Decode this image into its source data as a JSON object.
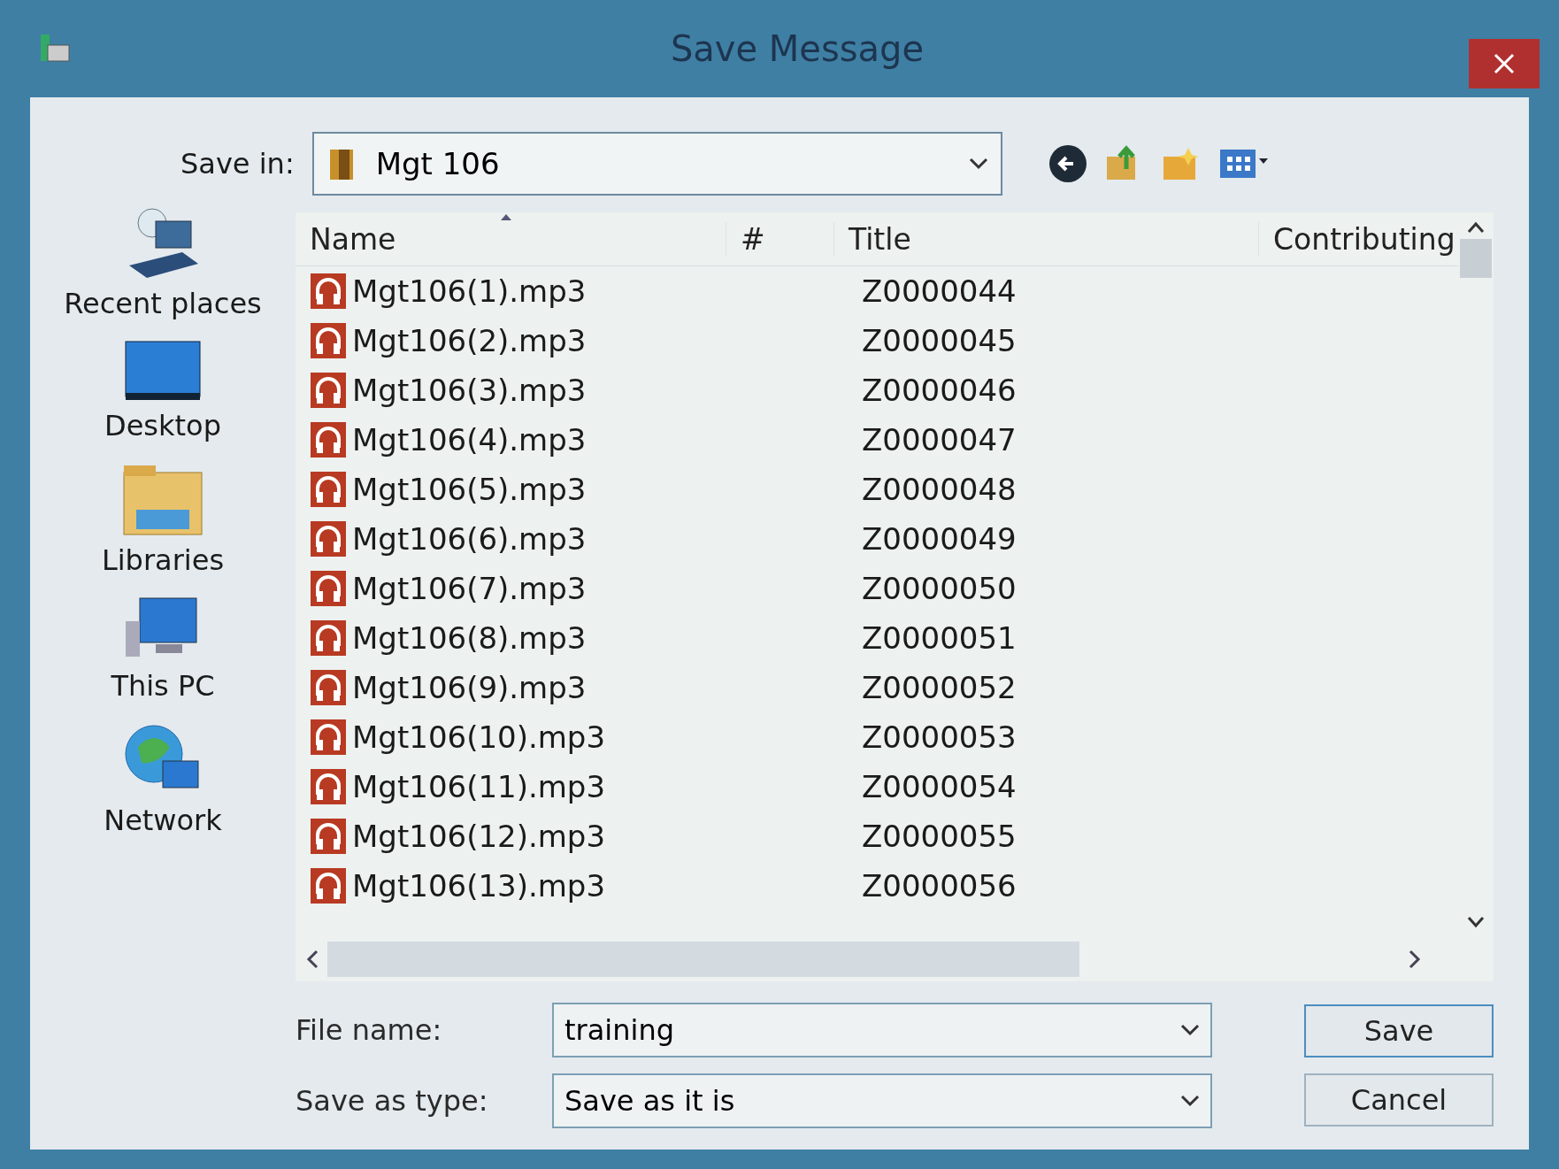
{
  "window": {
    "title": "Save Message"
  },
  "places": [
    {
      "kind": "recent",
      "label": "Recent places"
    },
    {
      "kind": "desktop",
      "label": "Desktop"
    },
    {
      "kind": "libraries",
      "label": "Libraries"
    },
    {
      "kind": "pc",
      "label": "This PC"
    },
    {
      "kind": "network",
      "label": "Network"
    }
  ],
  "save_in": {
    "label": "Save in:",
    "value": "Mgt 106"
  },
  "table": {
    "columns": [
      "Name",
      "#",
      "Title",
      "Contributing"
    ],
    "rows": [
      {
        "name": "Mgt106(1).mp3",
        "title": "Z0000044"
      },
      {
        "name": "Mgt106(2).mp3",
        "title": "Z0000045"
      },
      {
        "name": "Mgt106(3).mp3",
        "title": "Z0000046"
      },
      {
        "name": "Mgt106(4).mp3",
        "title": "Z0000047"
      },
      {
        "name": "Mgt106(5).mp3",
        "title": "Z0000048"
      },
      {
        "name": "Mgt106(6).mp3",
        "title": "Z0000049"
      },
      {
        "name": "Mgt106(7).mp3",
        "title": "Z0000050"
      },
      {
        "name": "Mgt106(8).mp3",
        "title": "Z0000051"
      },
      {
        "name": "Mgt106(9).mp3",
        "title": "Z0000052"
      },
      {
        "name": "Mgt106(10).mp3",
        "title": "Z0000053"
      },
      {
        "name": "Mgt106(11).mp3",
        "title": "Z0000054"
      },
      {
        "name": "Mgt106(12).mp3",
        "title": "Z0000055"
      },
      {
        "name": "Mgt106(13).mp3",
        "title": "Z0000056"
      }
    ]
  },
  "file_name": {
    "label": "File name:",
    "value": "training"
  },
  "save_as_type": {
    "label": "Save as type:",
    "value": "Save as it is"
  },
  "buttons": [
    "Save",
    "Cancel"
  ]
}
